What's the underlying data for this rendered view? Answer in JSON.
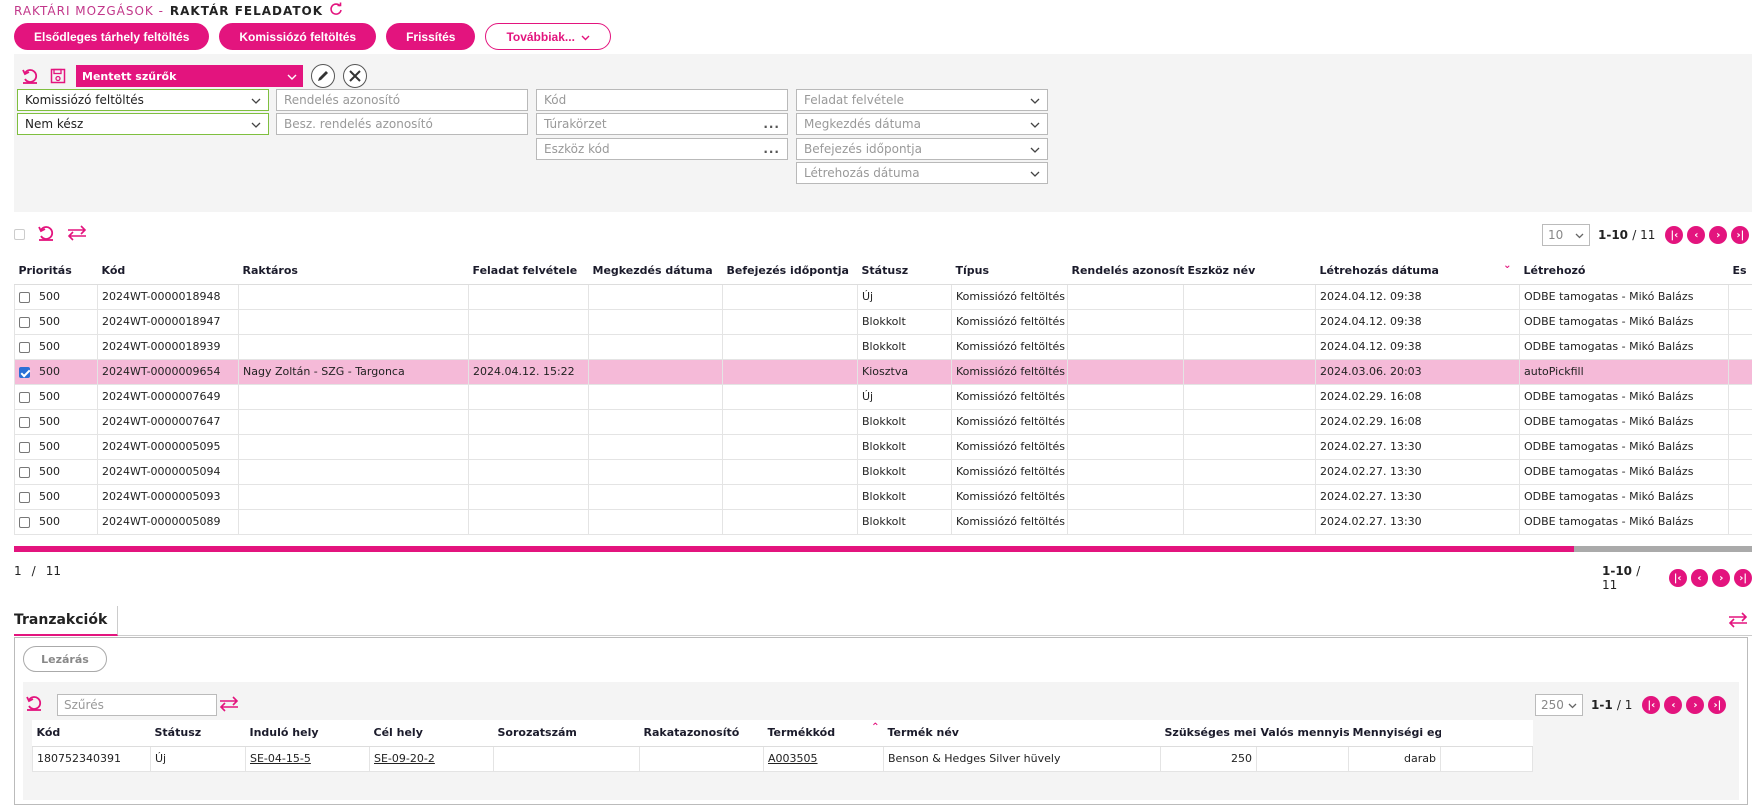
{
  "breadcrumb": {
    "parent": "RAKTÁRI MOZGÁSOK -",
    "current": "RAKTÁR FELADATOK"
  },
  "actions": {
    "primary_fill": "Elsődleges tárhely feltöltés",
    "picking_fill": "Komissiózó feltöltés",
    "refresh": "Frissítés",
    "more": "Továbbiak..."
  },
  "filters": {
    "saved_filters_label": "Mentett szűrők",
    "task_type": "Komissiózó feltöltés",
    "status": "Nem kész",
    "order_id_placeholder": "Rendelés azonosító",
    "purchase_order_placeholder": "Besz. rendelés azonosító",
    "code_placeholder": "Kód",
    "tour_area_placeholder": "Túrakörzet",
    "device_code_placeholder": "Eszköz kód",
    "task_pickup_placeholder": "Feladat felvétele",
    "start_date_placeholder": "Megkezdés dátuma",
    "end_time_placeholder": "Befejezés időpontja",
    "created_date_placeholder": "Létrehozás dátuma"
  },
  "grid": {
    "page_size": "10",
    "range": "1-10",
    "total": "/ 11",
    "footer_page": "1",
    "footer_sep": "/",
    "footer_total": "11",
    "columns": [
      "Prioritás",
      "Kód",
      "Raktáros",
      "Feladat felvétele",
      "Megkezdés dátuma",
      "Befejezés időpontja",
      "Státusz",
      "Típus",
      "Rendelés azonosít",
      "Eszköz név",
      "Létrehozás dátuma",
      "Létrehozó",
      "Es"
    ],
    "rows": [
      {
        "checked": false,
        "priority": "500",
        "code": "2024WT-0000018948",
        "worker": "",
        "pickup": "",
        "start": "",
        "end": "",
        "status": "Új",
        "type": "Komissiózó feltöltés",
        "order": "",
        "device": "",
        "created": "2024.04.12. 09:38",
        "creator": "ODBE tamogatas - Mikó Balázs"
      },
      {
        "checked": false,
        "priority": "500",
        "code": "2024WT-0000018947",
        "worker": "",
        "pickup": "",
        "start": "",
        "end": "",
        "status": "Blokkolt",
        "type": "Komissiózó feltöltés",
        "order": "",
        "device": "",
        "created": "2024.04.12. 09:38",
        "creator": "ODBE tamogatas - Mikó Balázs"
      },
      {
        "checked": false,
        "priority": "500",
        "code": "2024WT-0000018939",
        "worker": "",
        "pickup": "",
        "start": "",
        "end": "",
        "status": "Blokkolt",
        "type": "Komissiózó feltöltés",
        "order": "",
        "device": "",
        "created": "2024.04.12. 09:38",
        "creator": "ODBE tamogatas - Mikó Balázs"
      },
      {
        "checked": true,
        "priority": "500",
        "code": "2024WT-0000009654",
        "worker": "Nagy Zoltán - SZG - Targonca",
        "pickup": "2024.04.12. 15:22",
        "start": "",
        "end": "",
        "status": "Kiosztva",
        "type": "Komissiózó feltöltés",
        "order": "",
        "device": "",
        "created": "2024.03.06. 20:03",
        "creator": "autoPickfill"
      },
      {
        "checked": false,
        "priority": "500",
        "code": "2024WT-0000007649",
        "worker": "",
        "pickup": "",
        "start": "",
        "end": "",
        "status": "Új",
        "type": "Komissiózó feltöltés",
        "order": "",
        "device": "",
        "created": "2024.02.29. 16:08",
        "creator": "ODBE tamogatas - Mikó Balázs"
      },
      {
        "checked": false,
        "priority": "500",
        "code": "2024WT-0000007647",
        "worker": "",
        "pickup": "",
        "start": "",
        "end": "",
        "status": "Blokkolt",
        "type": "Komissiózó feltöltés",
        "order": "",
        "device": "",
        "created": "2024.02.29. 16:08",
        "creator": "ODBE tamogatas - Mikó Balázs"
      },
      {
        "checked": false,
        "priority": "500",
        "code": "2024WT-0000005095",
        "worker": "",
        "pickup": "",
        "start": "",
        "end": "",
        "status": "Blokkolt",
        "type": "Komissiózó feltöltés",
        "order": "",
        "device": "",
        "created": "2024.02.27. 13:30",
        "creator": "ODBE tamogatas - Mikó Balázs"
      },
      {
        "checked": false,
        "priority": "500",
        "code": "2024WT-0000005094",
        "worker": "",
        "pickup": "",
        "start": "",
        "end": "",
        "status": "Blokkolt",
        "type": "Komissiózó feltöltés",
        "order": "",
        "device": "",
        "created": "2024.02.27. 13:30",
        "creator": "ODBE tamogatas - Mikó Balázs"
      },
      {
        "checked": false,
        "priority": "500",
        "code": "2024WT-0000005093",
        "worker": "",
        "pickup": "",
        "start": "",
        "end": "",
        "status": "Blokkolt",
        "type": "Komissiózó feltöltés",
        "order": "",
        "device": "",
        "created": "2024.02.27. 13:30",
        "creator": "ODBE tamogatas - Mikó Balázs"
      },
      {
        "checked": false,
        "priority": "500",
        "code": "2024WT-0000005089",
        "worker": "",
        "pickup": "",
        "start": "",
        "end": "",
        "status": "Blokkolt",
        "type": "Komissiózó feltöltés",
        "order": "",
        "device": "",
        "created": "2024.02.27. 13:30",
        "creator": "ODBE tamogatas - Mikó Balázs"
      }
    ]
  },
  "transactions": {
    "tab_label": "Tranzakciók",
    "close_button": "Lezárás",
    "search_placeholder": "Szűrés",
    "page_size": "250",
    "range": "1-1",
    "total": "/ 1",
    "columns": [
      "Kód",
      "Státusz",
      "Induló hely",
      "Cél hely",
      "Sorozatszám",
      "Rakatazonosító",
      "Termékkód",
      "Termék név",
      "Szükséges mei",
      "Valós mennyis",
      "Mennyiségi eg"
    ],
    "rows": [
      {
        "code": "180752340391",
        "status": "Új",
        "from": "SE-04-15-5",
        "to": "SE-09-20-2",
        "serial": "",
        "pallet": "",
        "product_code": "A003505",
        "product_name": "Benson & Hedges Silver hüvely",
        "required": "250",
        "actual": "",
        "unit": "darab"
      }
    ]
  },
  "colors": {
    "accent": "#e3147e",
    "selected_row": "#f5bad8",
    "valid_border": "#7fbf3f"
  },
  "icons": [
    "refresh-icon",
    "save-icon",
    "edit-icon",
    "clear-icon",
    "columns-icon",
    "chevron-down-icon",
    "first-page-icon",
    "prev-page-icon",
    "next-page-icon",
    "last-page-icon",
    "sort-icon"
  ]
}
